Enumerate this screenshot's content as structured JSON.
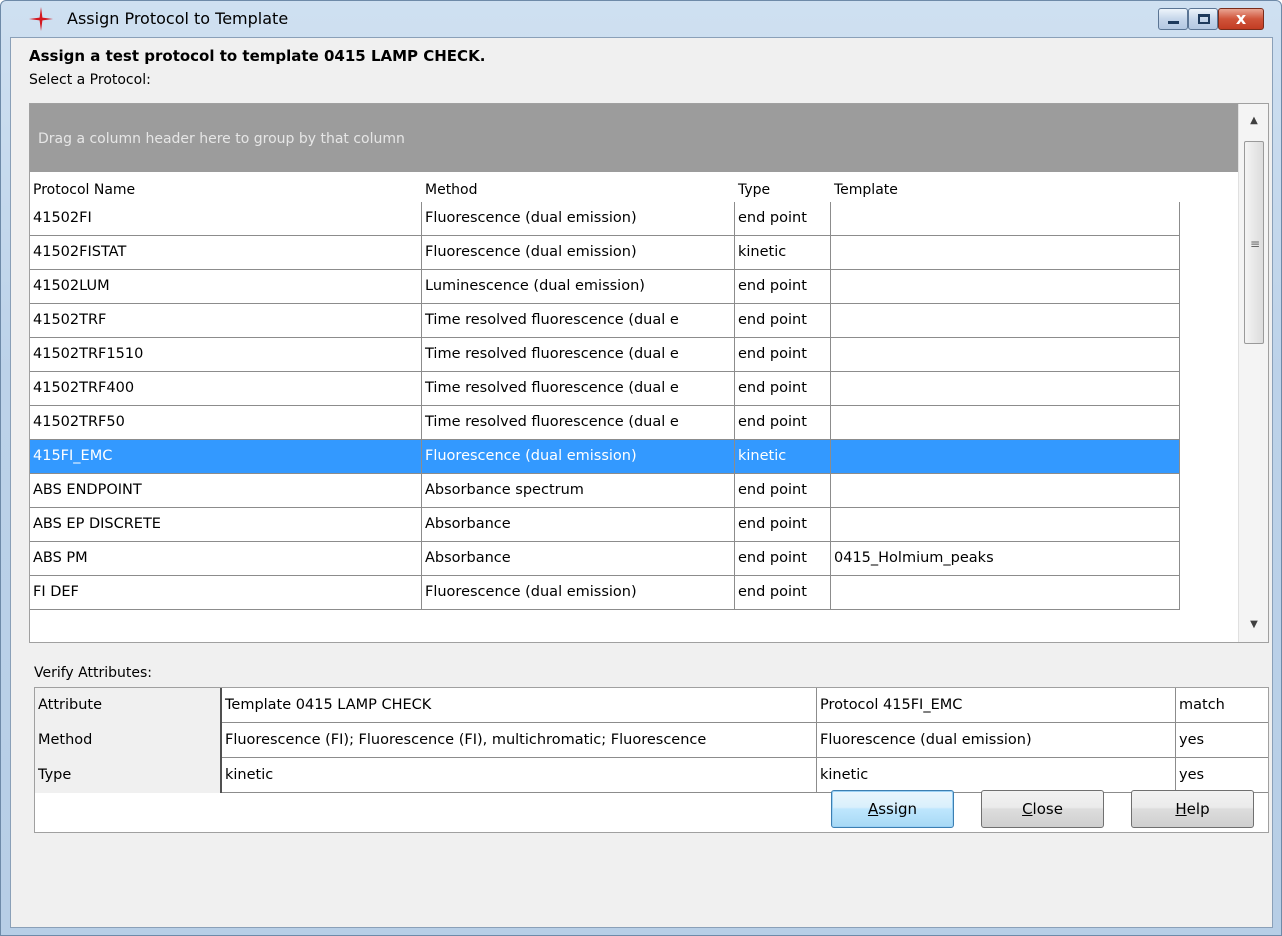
{
  "window": {
    "title": "Assign Protocol to Template",
    "controls": {
      "minimize": "_",
      "maximize": "□",
      "close": "x"
    }
  },
  "heading": "Assign a test protocol to template 0415 LAMP CHECK.",
  "select_label": "Select a Protocol:",
  "protocol_grid": {
    "group_panel_text": "Drag a column header here to group by that column",
    "columns": [
      "Protocol Name",
      "Method",
      "Type",
      "Template"
    ],
    "rows": [
      [
        "41502FI",
        "Fluorescence (dual emission)",
        "end point",
        ""
      ],
      [
        "41502FISTAT",
        "Fluorescence (dual emission)",
        "kinetic",
        ""
      ],
      [
        "41502LUM",
        "Luminescence (dual emission)",
        "end point",
        ""
      ],
      [
        "41502TRF",
        "Time resolved fluorescence (dual e",
        "end point",
        ""
      ],
      [
        "41502TRF1510",
        "Time resolved fluorescence (dual e",
        "end point",
        ""
      ],
      [
        "41502TRF400",
        "Time resolved fluorescence (dual e",
        "end point",
        ""
      ],
      [
        "41502TRF50",
        "Time resolved fluorescence (dual e",
        "end point",
        ""
      ],
      [
        "415FI_EMC",
        "Fluorescence (dual emission)",
        "kinetic",
        ""
      ],
      [
        "ABS ENDPOINT",
        "Absorbance spectrum",
        "end point",
        ""
      ],
      [
        "ABS EP DISCRETE",
        "Absorbance",
        "end point",
        ""
      ],
      [
        "ABS PM",
        "Absorbance",
        "end point",
        "0415_Holmium_peaks"
      ],
      [
        "FI DEF",
        "Fluorescence (dual emission)",
        "end point",
        ""
      ]
    ],
    "selected_row": "415FI_EMC"
  },
  "verify": {
    "label": "Verify Attributes:",
    "header": [
      "Attribute",
      "Template 0415 LAMP CHECK",
      "Protocol 415FI_EMC",
      "match"
    ],
    "rows": [
      [
        "Method",
        "Fluorescence (FI); Fluorescence (FI), multichromatic; Fluorescence",
        "Fluorescence (dual emission)",
        "yes"
      ],
      [
        "Type",
        "kinetic",
        "kinetic",
        "yes"
      ]
    ]
  },
  "buttons": {
    "assign": {
      "mnemonic": "A",
      "rest": "ssign"
    },
    "close": {
      "mnemonic": "C",
      "rest": "lose"
    },
    "help": {
      "mnemonic": "H",
      "rest": "elp"
    }
  },
  "colors": {
    "selection": "#3399ff",
    "group_panel": "#9c9c9c",
    "dialog_bg": "#f0f0f0"
  },
  "icons": {
    "app": "red-crosshair-star-icon"
  }
}
